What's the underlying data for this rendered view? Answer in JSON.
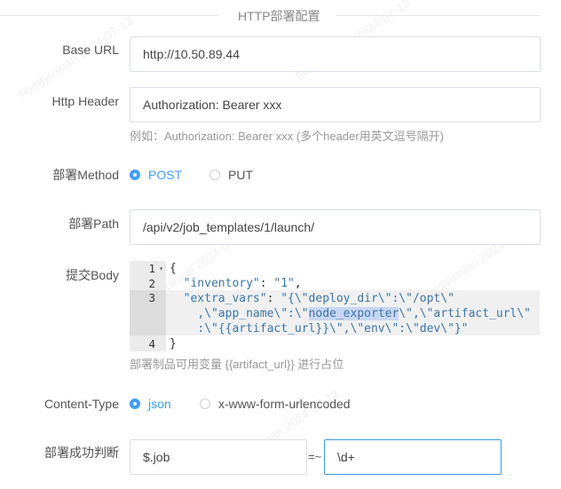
{
  "section": {
    "title": "HTTP部署配置"
  },
  "base_url": {
    "label": "Base URL",
    "value": "http://10.50.89.44"
  },
  "http_header": {
    "label": "Http Header",
    "value": "Authorization: Bearer xxx",
    "hint": "例如：Authorization: Bearer xxx (多个header用英文逗号隔开)"
  },
  "method": {
    "label": "部署Method",
    "options": [
      "POST",
      "PUT"
    ],
    "selected": "POST"
  },
  "path": {
    "label": "部署Path",
    "value": "/api/v2/job_templates/1/launch/"
  },
  "body": {
    "label": "提交Body",
    "line_numbers": [
      "1",
      "2",
      "3",
      "4"
    ],
    "lines": {
      "l1": "{",
      "l2_key": "\"inventory\"",
      "l2_sep": ": ",
      "l2_val": "\"1\"",
      "l2_end": ",",
      "l3_key": "\"extra_vars\"",
      "l3_sep": ": ",
      "l3_val_a": "\"{\\\"deploy_dir\\\":\\\"/opt\\\"",
      "l3_val_b1": ",\\\"app_name\\\":\\\"",
      "l3_val_b_sel": "node_exporter",
      "l3_val_b2": "\\\",\\\"artifact_url\\\"",
      "l3_val_c": ":\\\"{{artifact_url}}\\\",\\\"env\\\":\\\"dev\\\"}\"",
      "l4": "}"
    },
    "hint": "部署制品可用变量 {{artifact_url}} 进行占位"
  },
  "content_type": {
    "label": "Content-Type",
    "options": [
      "json",
      "x-www-form-urlencoded"
    ],
    "selected": "json"
  },
  "success": {
    "label": "部署成功判断",
    "expr": "$.job",
    "operator": "=~",
    "pattern": "\\d+"
  },
  "watermark": {
    "text": "hongyuxuan 2024-07-13"
  }
}
